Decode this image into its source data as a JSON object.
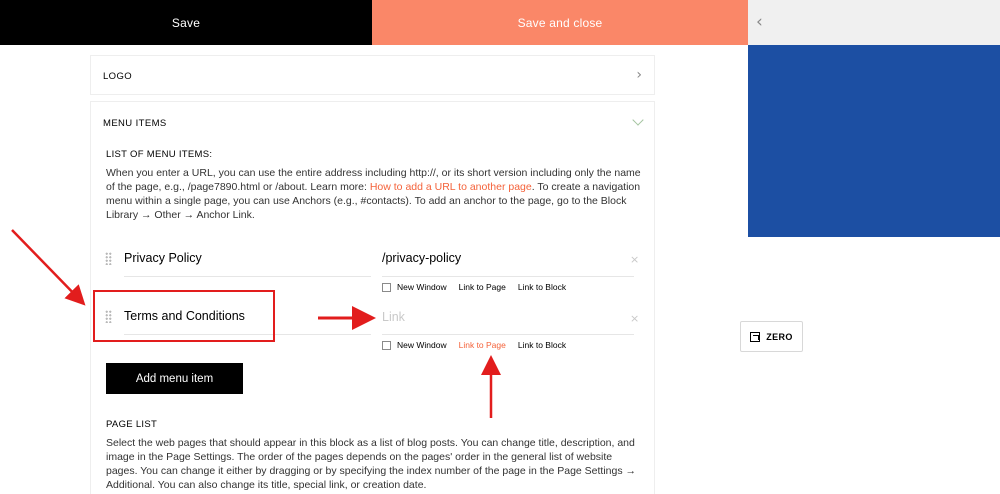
{
  "toolbar": {
    "save_label": "Save",
    "save_close_label": "Save and close",
    "collapse_icon": "chevron-left-icon"
  },
  "sections": {
    "logo": {
      "title": "LOGO"
    },
    "menu": {
      "title": "MENU ITEMS"
    }
  },
  "menu_items": {
    "list_label": "LIST OF MENU ITEMS:",
    "description_part1": "When you enter a URL, you can use the entire address including http://, or its short version including only the name of the page, e.g., /page7890.html or /about. Learn more: ",
    "description_link": "How to add a URL to another page",
    "description_part2": ". To create a navigation menu within a single page, you can use Anchors (e.g., #contacts). To add an anchor to the page, go to the Block Library → Other → Anchor Link.",
    "items": [
      {
        "name": "Privacy Policy",
        "url": "/privacy-policy",
        "url_placeholder": "Link",
        "options": {
          "new_window": "New Window",
          "link_to_page": "Link to Page",
          "link_to_block": "Link to Block"
        },
        "active_option": ""
      },
      {
        "name": "Terms and Conditions",
        "url": "",
        "url_placeholder": "Link",
        "options": {
          "new_window": "New Window",
          "link_to_page": "Link to Page",
          "link_to_block": "Link to Block"
        },
        "active_option": "link_to_page"
      }
    ],
    "add_button_label": "Add menu item"
  },
  "page_list": {
    "label": "PAGE LIST",
    "description": "Select the web pages that should appear in this block as a list of blog posts. You can change title, description, and image in the Page Settings. The order of the pages depends on the pages' order in the general list of website pages. You can change it either by dragging or by specifying the index number of the page in the Page Settings → Additional. You can also change its title, special link, or creation date."
  },
  "preview": {
    "zero_label": "ZERO",
    "block_color": "#1c4fa3"
  },
  "colors": {
    "accent": "#fa8768",
    "link": "#f4623a",
    "annotation": "#e21d1d"
  }
}
